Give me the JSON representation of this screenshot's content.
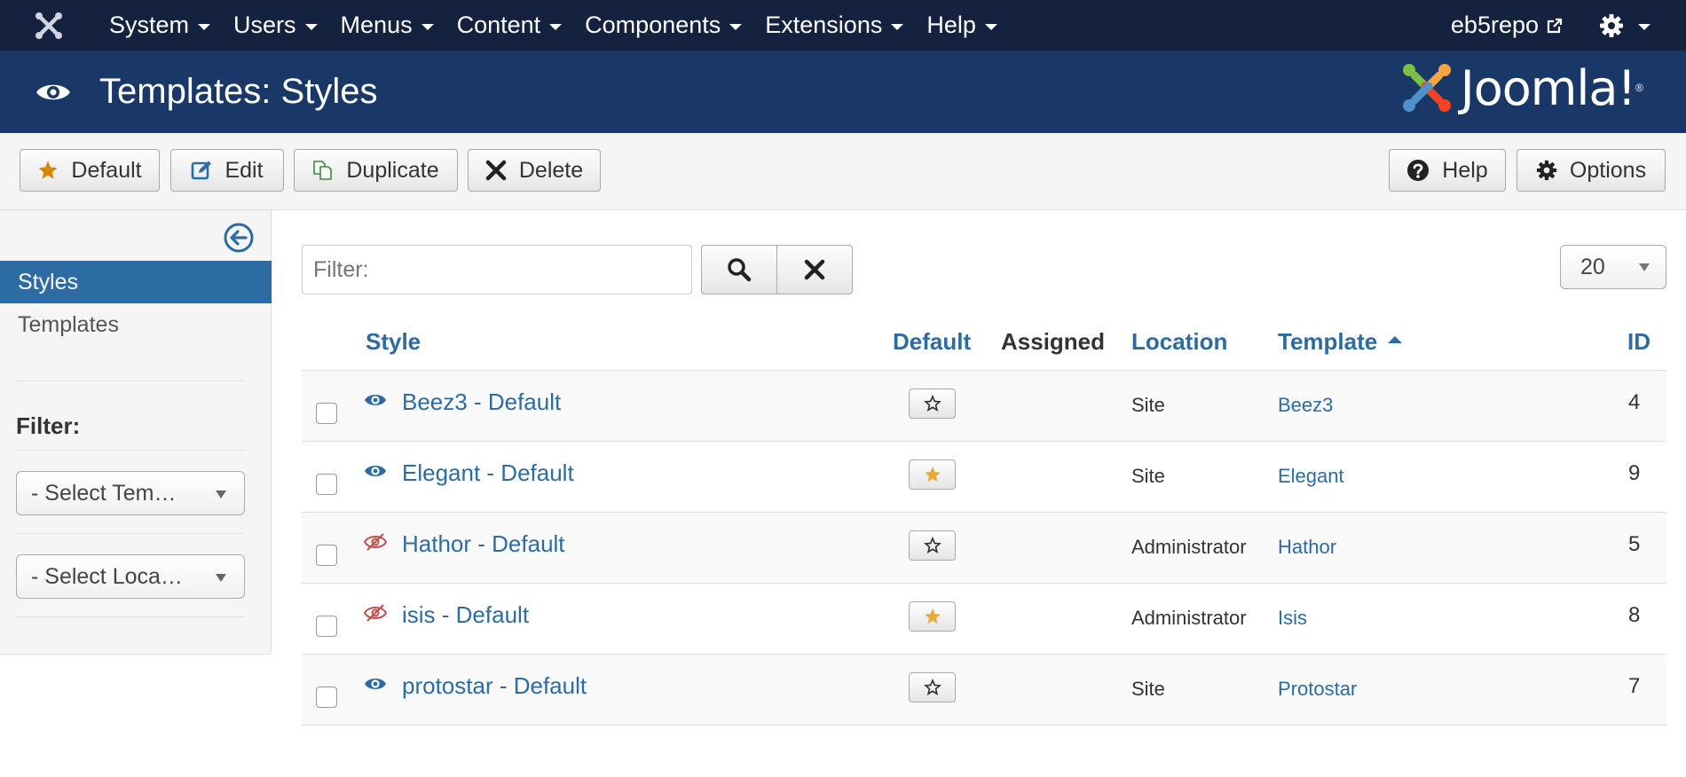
{
  "nav": {
    "menu": [
      {
        "label": "System"
      },
      {
        "label": "Users"
      },
      {
        "label": "Menus"
      },
      {
        "label": "Content"
      },
      {
        "label": "Components"
      },
      {
        "label": "Extensions"
      },
      {
        "label": "Help"
      }
    ],
    "site_name": "eb5repo"
  },
  "header": {
    "title": "Templates: Styles",
    "brand": "Joomla!",
    "brand_mark": "®"
  },
  "toolbar": {
    "default_label": "Default",
    "edit_label": "Edit",
    "duplicate_label": "Duplicate",
    "delete_label": "Delete",
    "help_label": "Help",
    "options_label": "Options"
  },
  "sidebar": {
    "items": [
      {
        "label": "Styles",
        "active": true
      },
      {
        "label": "Templates",
        "active": false
      }
    ],
    "filter_label": "Filter:",
    "select_template": "- Select Tem…",
    "select_location": "- Select Loca…"
  },
  "search": {
    "placeholder": "Filter:",
    "limit": "20"
  },
  "table": {
    "columns": {
      "style": "Style",
      "default": "Default",
      "assigned": "Assigned",
      "location": "Location",
      "template": "Template",
      "id": "ID"
    },
    "sort_column": "Template",
    "rows": [
      {
        "style": "Beez3 - Default",
        "published": true,
        "is_default": false,
        "location": "Site",
        "template": "Beez3",
        "id": "4"
      },
      {
        "style": "Elegant - Default",
        "published": true,
        "is_default": true,
        "location": "Site",
        "template": "Elegant",
        "id": "9"
      },
      {
        "style": "Hathor - Default",
        "published": false,
        "is_default": false,
        "location": "Administrator",
        "template": "Hathor",
        "id": "5"
      },
      {
        "style": "isis - Default",
        "published": false,
        "is_default": true,
        "location": "Administrator",
        "template": "Isis",
        "id": "8"
      },
      {
        "style": "protostar - Default",
        "published": true,
        "is_default": false,
        "location": "Site",
        "template": "Protostar",
        "id": "7"
      }
    ]
  },
  "colors": {
    "nav_bg": "#14223f",
    "header_bg": "#1a3867",
    "link": "#2d6ca2",
    "star_default": "#e8a935",
    "unpublished_eye": "#c0504d",
    "toolbar_star": "#d48a00",
    "edit_icon": "#2d6ca2",
    "duplicate_icon": "#3a8a3a"
  }
}
